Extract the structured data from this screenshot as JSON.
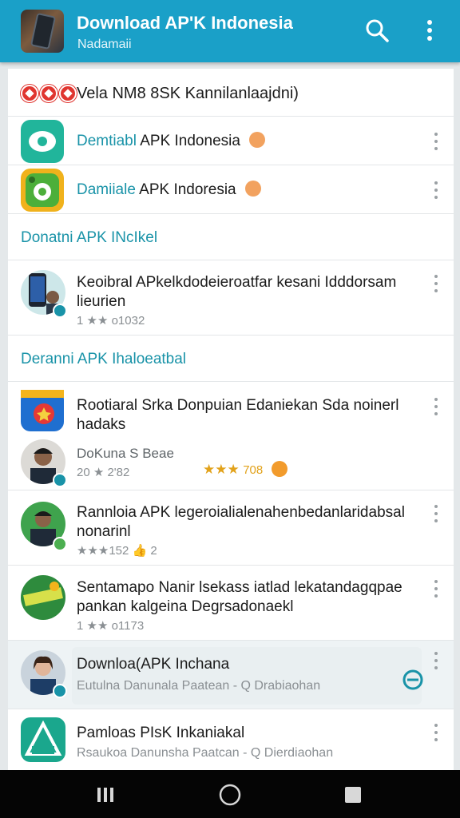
{
  "app_bar": {
    "title": "Download AP'K Indonesia",
    "subtitle": "Nadamaii",
    "search_icon": "search-icon",
    "more_icon": "more-vert-icon"
  },
  "list": {
    "top_row": {
      "text": "Vela ΝΜ8 8SK Kannilanlaajdni)"
    },
    "apps": [
      {
        "prefix": "Demtiabl",
        "name": "APK Indonesia"
      },
      {
        "prefix": "Damiiale",
        "name": "APK Indoresia"
      }
    ],
    "section_1": "Donatni APK INcIkel",
    "post_1": {
      "title": "Keoibral APkelkdodeieroatfar kesani Idddorsam lieurien",
      "meta": "1 ★★ o1032"
    },
    "section_2": "Deranni APK Ihaloeatbal",
    "post_2": {
      "title": "Rootiaral Srka Donpuian Edaniekan Sda noinerl hadaks",
      "author": "DoKuna S Beae",
      "meta": "20 ★ 2'82",
      "rating_stars": "★★★",
      "rating_value": "708"
    },
    "post_3": {
      "title": "Rannloia APK legeroialialenahenbedanlaridabsal nonarinl",
      "meta": "★★★152",
      "count": "2"
    },
    "post_4": {
      "title": "Sentamapo Nanir lsekass iatlad lekatandagqpae pankan kalgeina Degrsadonaekl",
      "meta": "1 ★★ o1173"
    },
    "post_5": {
      "title": "Downloa(APK Inchana",
      "subtitle": "Eutulna Danunala Paatean - Q Drabiaohan"
    },
    "post_6": {
      "title": "Pamloas PIsK Inkaniakal",
      "subtitle": "Rsaukoa Danunsha Paatcan - Q Dierdiaohan"
    }
  },
  "colors": {
    "accent": "#1aa0c8",
    "teal_text": "#1993a8",
    "badge_red": "#e0352f",
    "star_gold": "#e2a21b"
  },
  "nav_bar": {
    "recents_icon": "recents-icon",
    "home_icon": "home-icon",
    "back_icon": "overview-square-icon"
  }
}
